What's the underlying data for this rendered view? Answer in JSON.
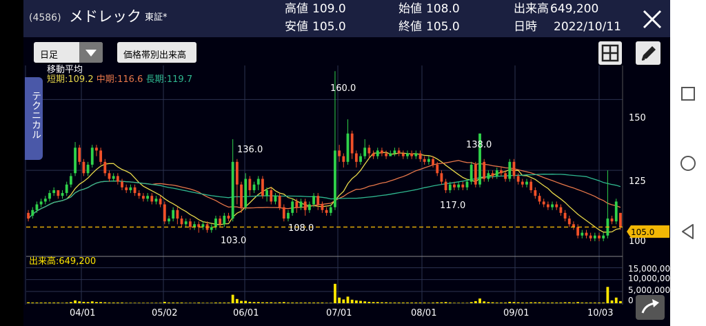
{
  "header": {
    "code": "(4586)",
    "name": "メドレック",
    "exchange": "東証*",
    "high_label": "高値",
    "high_value": "109.0",
    "low_label": "安値",
    "low_value": "105.0",
    "open_label": "始値",
    "open_value": "108.0",
    "close_label": "終値",
    "close_value": "105.0",
    "volume_label": "出来高",
    "volume_value": "649,200",
    "date_label": "日時",
    "date_value": "2022/10/11"
  },
  "toolbar": {
    "period": "日足",
    "volume_by_price": "価格帯別出来高"
  },
  "side_tab": "テクニカル",
  "moving_average": {
    "title": "移動平均",
    "short_label": "短期:109.2",
    "mid_label": "中期:116.6",
    "long_label": "長期:119.7"
  },
  "colors": {
    "up": "#2fd24a",
    "down": "#f05028",
    "short_ma": "#e8d84a",
    "mid_ma": "#e8774a",
    "long_ma": "#2fb890",
    "volume": "#ffe600",
    "badge": "#f2b705",
    "background": "#000010",
    "header": "#1b2040"
  },
  "volume_panel": {
    "label": "出来高:649,200"
  },
  "price_badge": "105.0",
  "chart_data": {
    "type": "candlestick",
    "y_ticks": [
      "150",
      "125",
      "100"
    ],
    "volume_ticks": [
      "15,000,000",
      "10,000,000",
      "5,000,000",
      "0"
    ],
    "x_labels": [
      "04/01",
      "05/02",
      "06/01",
      "07/01",
      "08/01",
      "09/01",
      "10/03"
    ],
    "annotations": [
      "160.0",
      "136.0",
      "103.0",
      "108.0",
      "138.0",
      "117.0"
    ],
    "ylim": [
      100,
      162
    ],
    "current_price": 105.0,
    "ma_short_last": 109.2,
    "ma_mid_last": 116.6,
    "ma_long_last": 119.7,
    "candles": [
      [
        110,
        108,
        111,
        107,
        0.4
      ],
      [
        109,
        111,
        112,
        108,
        0.3
      ],
      [
        111,
        113,
        114,
        110,
        0.3
      ],
      [
        113,
        114,
        115,
        112,
        0.3
      ],
      [
        114,
        115,
        116,
        113,
        0.3
      ],
      [
        115,
        117,
        118,
        114,
        0.3
      ],
      [
        117,
        118,
        119,
        116,
        0.3
      ],
      [
        118,
        116,
        118,
        115,
        0.3
      ],
      [
        116,
        117,
        118,
        115,
        0.2
      ],
      [
        117,
        120,
        121,
        116,
        0.3
      ],
      [
        120,
        123,
        124,
        119,
        0.5
      ],
      [
        124,
        133,
        135,
        123,
        1.2
      ],
      [
        133,
        128,
        134,
        127,
        0.8
      ],
      [
        128,
        124,
        129,
        123,
        0.6
      ],
      [
        124,
        127,
        128,
        123,
        0.5
      ],
      [
        127,
        133,
        134,
        126,
        0.8
      ],
      [
        133,
        132,
        134,
        130,
        0.5
      ],
      [
        132,
        128,
        133,
        127,
        0.5
      ],
      [
        128,
        124,
        129,
        123,
        0.4
      ],
      [
        124,
        122,
        125,
        121,
        0.3
      ],
      [
        122,
        123,
        124,
        121,
        0.3
      ],
      [
        123,
        121,
        124,
        120,
        0.3
      ],
      [
        121,
        119,
        122,
        118,
        0.3
      ],
      [
        119,
        118,
        120,
        117,
        0.2
      ],
      [
        118,
        119,
        120,
        117,
        0.2
      ],
      [
        119,
        117,
        120,
        116,
        0.2
      ],
      [
        117,
        116,
        118,
        115,
        0.2
      ],
      [
        116,
        115,
        117,
        114,
        0.2
      ],
      [
        115,
        116,
        117,
        114,
        0.2
      ],
      [
        116,
        114,
        117,
        113,
        0.2
      ],
      [
        114,
        115,
        116,
        113,
        0.2
      ],
      [
        115,
        113,
        116,
        112,
        0.2
      ],
      [
        113,
        107,
        114,
        106,
        0.6
      ],
      [
        107,
        108,
        109,
        106,
        0.3
      ],
      [
        108,
        111,
        112,
        107,
        0.3
      ],
      [
        111,
        108,
        112,
        106,
        0.3
      ],
      [
        108,
        106,
        109,
        105,
        0.3
      ],
      [
        106,
        107,
        108,
        105,
        0.2
      ],
      [
        107,
        105,
        108,
        104,
        0.2
      ],
      [
        105,
        106,
        107,
        104,
        0.2
      ],
      [
        106,
        105,
        107,
        103,
        0.3
      ],
      [
        105,
        106,
        107,
        104,
        0.2
      ],
      [
        106,
        104,
        107,
        103,
        0.2
      ],
      [
        104,
        105,
        106,
        103,
        0.2
      ],
      [
        105,
        108,
        109,
        104,
        0.3
      ],
      [
        108,
        106,
        109,
        105,
        0.3
      ],
      [
        106,
        109,
        110,
        105,
        0.3
      ],
      [
        109,
        108,
        110,
        107,
        0.3
      ],
      [
        108,
        128,
        136,
        107,
        3.6
      ],
      [
        128,
        120,
        129,
        113,
        1.8
      ],
      [
        120,
        112,
        121,
        110,
        1.0
      ],
      [
        112,
        122,
        124,
        111,
        1.0
      ],
      [
        122,
        118,
        123,
        116,
        0.6
      ],
      [
        118,
        120,
        121,
        117,
        0.5
      ],
      [
        120,
        122,
        123,
        118,
        0.5
      ],
      [
        122,
        116,
        123,
        115,
        0.4
      ],
      [
        116,
        118,
        119,
        114,
        0.4
      ],
      [
        118,
        114,
        119,
        113,
        0.4
      ],
      [
        114,
        116,
        117,
        113,
        0.3
      ],
      [
        116,
        112,
        117,
        111,
        0.4
      ],
      [
        112,
        108,
        113,
        107,
        0.5
      ],
      [
        108,
        110,
        111,
        107,
        0.3
      ],
      [
        110,
        114,
        115,
        109,
        0.3
      ],
      [
        114,
        112,
        115,
        110,
        0.3
      ],
      [
        112,
        114,
        115,
        111,
        0.3
      ],
      [
        114,
        111,
        115,
        109,
        0.3
      ],
      [
        111,
        113,
        114,
        110,
        0.3
      ],
      [
        113,
        116,
        117,
        112,
        0.3
      ],
      [
        116,
        113,
        117,
        111,
        0.3
      ],
      [
        113,
        111,
        114,
        110,
        0.3
      ],
      [
        111,
        110,
        112,
        109,
        0.2
      ],
      [
        110,
        112,
        113,
        109,
        0.2
      ],
      [
        112,
        132,
        160,
        111,
        8.2
      ],
      [
        132,
        130,
        134,
        128,
        2.4
      ],
      [
        130,
        128,
        131,
        126,
        1.6
      ],
      [
        128,
        138,
        143,
        127,
        2.8
      ],
      [
        138,
        131,
        139,
        129,
        1.5
      ],
      [
        131,
        128,
        132,
        126,
        1.2
      ],
      [
        128,
        130,
        131,
        127,
        1.0
      ],
      [
        130,
        133,
        136,
        129,
        0.8
      ],
      [
        133,
        131,
        134,
        129,
        0.6
      ],
      [
        131,
        130,
        132,
        129,
        0.5
      ],
      [
        130,
        132,
        133,
        129,
        0.5
      ],
      [
        132,
        131,
        133,
        130,
        0.4
      ],
      [
        131,
        130,
        132,
        129,
        0.4
      ],
      [
        130,
        131,
        132,
        130,
        0.3
      ],
      [
        131,
        132,
        133,
        130,
        0.3
      ],
      [
        132,
        131,
        133,
        130,
        0.3
      ],
      [
        131,
        130,
        132,
        129,
        0.3
      ],
      [
        130,
        131,
        132,
        129,
        0.3
      ],
      [
        131,
        130,
        132,
        129,
        0.3
      ],
      [
        130,
        131,
        132,
        129,
        0.3
      ],
      [
        131,
        129,
        132,
        128,
        0.3
      ],
      [
        129,
        128,
        130,
        127,
        0.3
      ],
      [
        128,
        129,
        130,
        127,
        0.2
      ],
      [
        129,
        127,
        130,
        126,
        0.3
      ],
      [
        127,
        124,
        128,
        123,
        0.4
      ],
      [
        124,
        121,
        125,
        120,
        0.4
      ],
      [
        121,
        118,
        122,
        117,
        0.5
      ],
      [
        118,
        120,
        121,
        117,
        0.3
      ],
      [
        120,
        119,
        121,
        118,
        0.2
      ],
      [
        119,
        120,
        121,
        118,
        0.2
      ],
      [
        120,
        119,
        121,
        118,
        0.2
      ],
      [
        119,
        121,
        122,
        118,
        0.2
      ],
      [
        121,
        127,
        128,
        120,
        0.5
      ],
      [
        127,
        120,
        128,
        119,
        0.9
      ],
      [
        120,
        138,
        138,
        119,
        2.0
      ],
      [
        128,
        122,
        129,
        121,
        0.8
      ],
      [
        122,
        124,
        125,
        121,
        0.5
      ],
      [
        124,
        123,
        125,
        122,
        0.4
      ],
      [
        123,
        125,
        126,
        122,
        0.3
      ],
      [
        125,
        124,
        126,
        123,
        0.3
      ],
      [
        124,
        122,
        125,
        121,
        0.3
      ],
      [
        122,
        128,
        129,
        121,
        0.6
      ],
      [
        128,
        123,
        129,
        122,
        0.5
      ],
      [
        123,
        121,
        124,
        120,
        0.4
      ],
      [
        121,
        120,
        122,
        119,
        0.3
      ],
      [
        120,
        121,
        122,
        119,
        0.3
      ],
      [
        121,
        118,
        122,
        117,
        0.4
      ],
      [
        118,
        116,
        119,
        115,
        0.4
      ],
      [
        116,
        114,
        117,
        113,
        0.4
      ],
      [
        114,
        113,
        115,
        112,
        0.3
      ],
      [
        113,
        112,
        114,
        111,
        0.3
      ],
      [
        112,
        113,
        114,
        111,
        0.3
      ],
      [
        113,
        112,
        114,
        111,
        0.3
      ],
      [
        112,
        110,
        113,
        109,
        0.3
      ],
      [
        110,
        108,
        111,
        107,
        0.4
      ],
      [
        108,
        106,
        109,
        105,
        0.4
      ],
      [
        106,
        105,
        107,
        104,
        0.3
      ],
      [
        105,
        102,
        106,
        101,
        0.5
      ],
      [
        102,
        103,
        104,
        101,
        0.3
      ],
      [
        103,
        102,
        104,
        101,
        0.3
      ],
      [
        102,
        101,
        103,
        100,
        0.3
      ],
      [
        101,
        102,
        103,
        100,
        0.3
      ],
      [
        102,
        101,
        103,
        100,
        0.3
      ],
      [
        101,
        102,
        103,
        100,
        0.3
      ],
      [
        102,
        108,
        125,
        101,
        6.9
      ],
      [
        108,
        107,
        109,
        106,
        1.2
      ],
      [
        107,
        114,
        115,
        106,
        2.4
      ],
      [
        110,
        105,
        110,
        104,
        0.9
      ]
    ]
  }
}
